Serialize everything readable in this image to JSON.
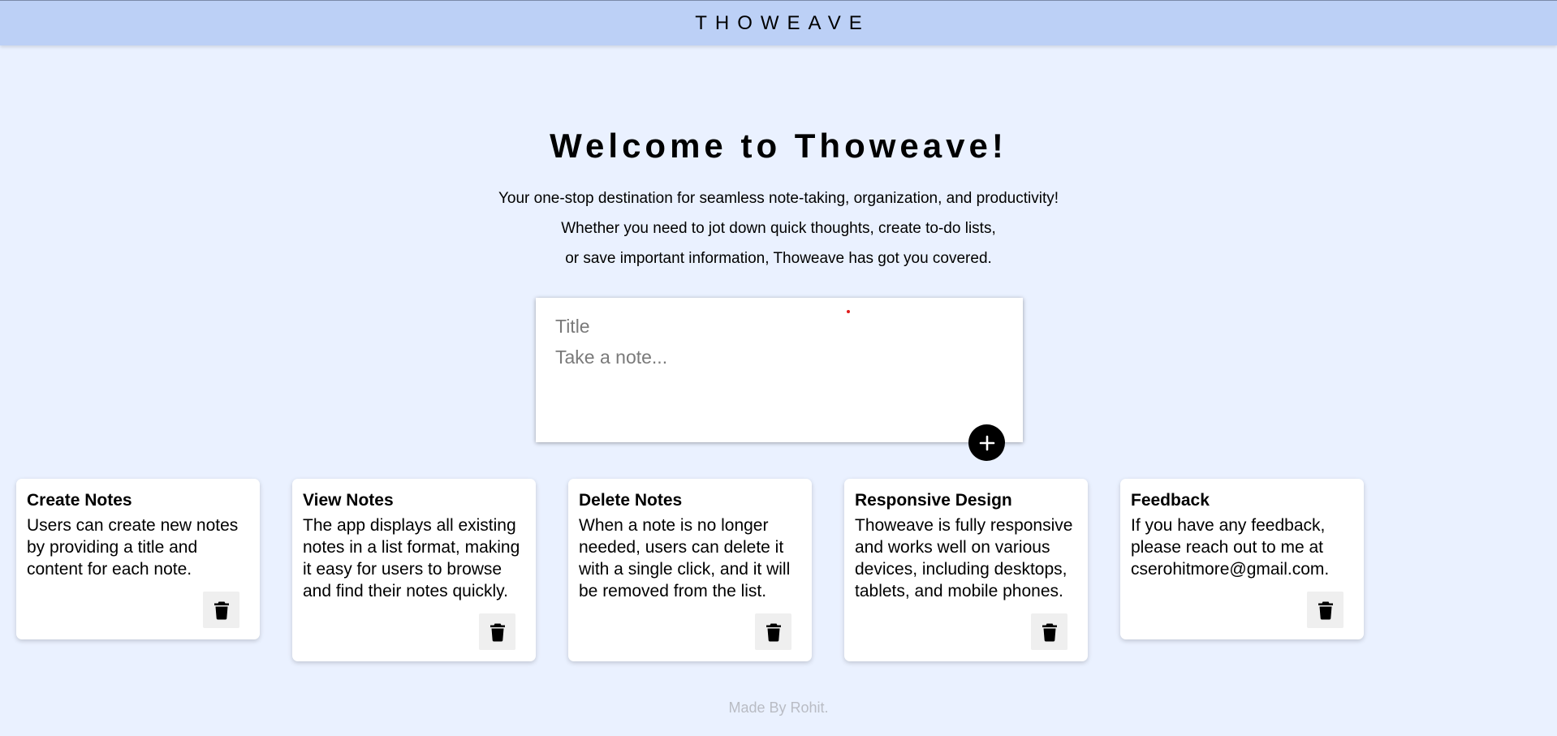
{
  "header": {
    "brand": "THOWEAVE"
  },
  "hero": {
    "title": "Welcome to Thoweave!",
    "lines": [
      "Your one-stop destination for seamless note-taking, organization, and productivity!",
      "Whether you need to jot down quick thoughts, create to-do lists,",
      "or save important information, Thoweave has got you covered."
    ]
  },
  "composer": {
    "title_placeholder": "Title",
    "content_placeholder": "Take a note...",
    "add_icon": "plus-icon"
  },
  "notes": [
    {
      "title": "Create Notes",
      "content": "Users can create new notes by providing a title and content for each note.",
      "delete_icon": "trash-icon"
    },
    {
      "title": "View Notes",
      "content": "The app displays all existing notes in a list format, making it easy for users to browse and find their notes quickly.",
      "delete_icon": "trash-icon"
    },
    {
      "title": "Delete Notes",
      "content": "When a note is no longer needed, users can delete it with a single click, and it will be removed from the list.",
      "delete_icon": "trash-icon"
    },
    {
      "title": "Responsive Design",
      "content": "Thoweave is fully responsive and works well on various devices, including desktops, tablets, and mobile phones.",
      "delete_icon": "trash-icon"
    },
    {
      "title": "Feedback",
      "content": "If you have any feedback, please reach out to me at cserohitmore@gmail.com.",
      "delete_icon": "trash-icon"
    }
  ],
  "footer": {
    "text": "Made By Rohit."
  },
  "colors": {
    "page_background": "#eaf1ff",
    "header_background": "#bcd0f6",
    "card_background": "#ffffff",
    "add_button": "#000000",
    "delete_button_background": "#efefef",
    "footer_text": "#b9bcc4"
  }
}
